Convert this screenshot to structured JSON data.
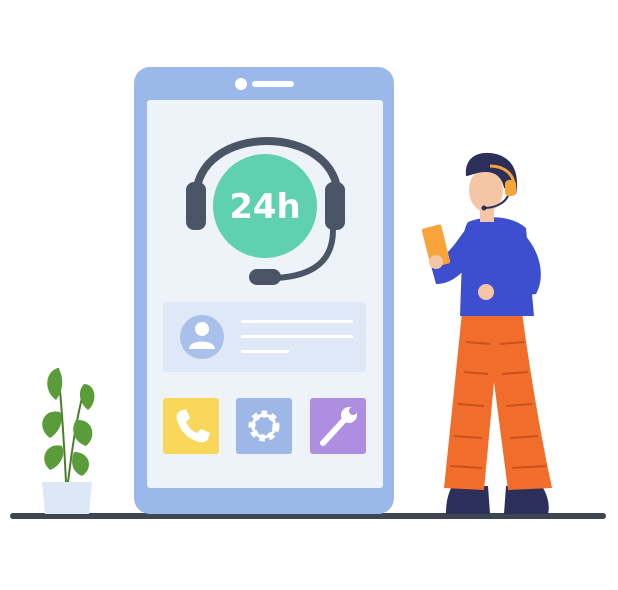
{
  "support_badge": {
    "label": "24h"
  },
  "icons": {
    "headset": "headset-icon",
    "user_avatar": "user-icon",
    "phone": "phone-icon",
    "settings": "gear-icon",
    "tools": "wrench-icon"
  },
  "colors": {
    "phone_frame": "#9bb8ea",
    "phone_screen": "#eef2f9",
    "badge": "#5fd1b0",
    "headset": "#4a5566",
    "profile_card": "#dfe8f7",
    "phone_tile": "#f9d75a",
    "settings_tile": "#9db8e6",
    "tools_tile": "#ae8ee0",
    "person_shirt": "#3d4fcf",
    "person_pants": "#f06d2c",
    "tablet": "#f7a43a",
    "plant_leaves": "#5a9b3a",
    "floor": "#3e4652"
  }
}
